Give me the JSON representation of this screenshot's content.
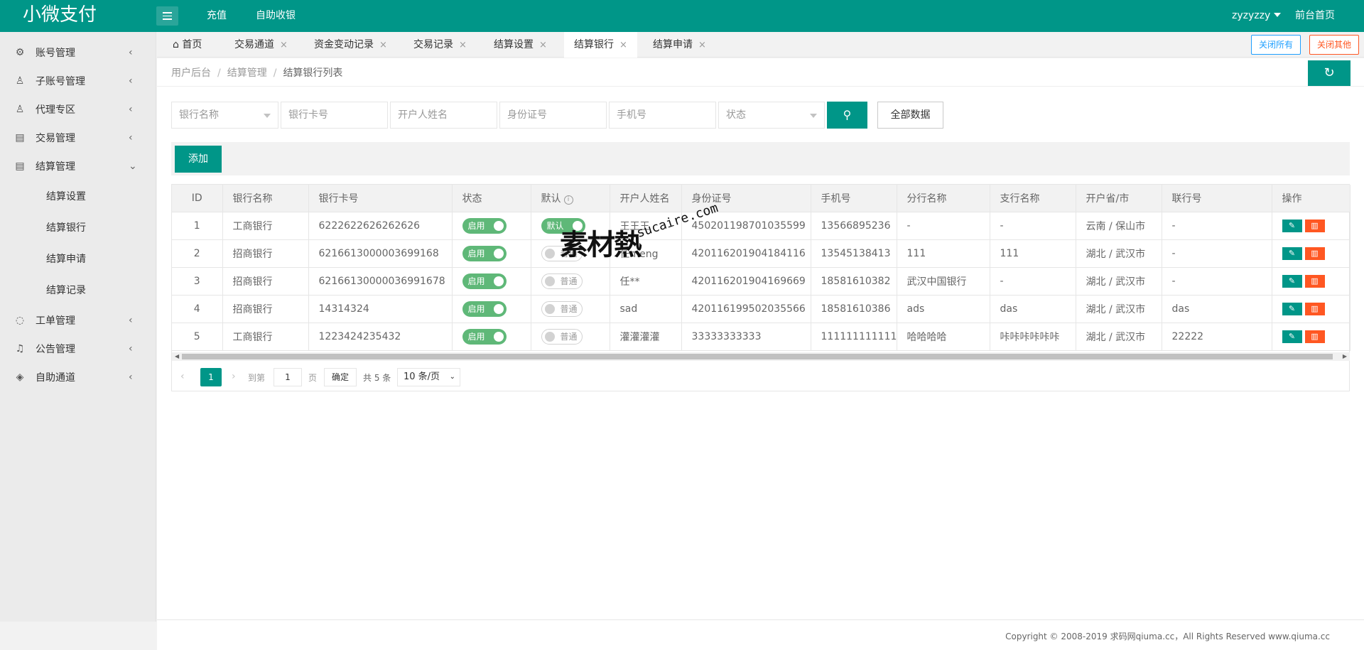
{
  "header": {
    "logo": "小微支付",
    "links": [
      "充值",
      "自助收银"
    ],
    "user": "zyzyzzy",
    "front": "前台首页"
  },
  "sidebar": {
    "items": [
      {
        "label": "账号管理",
        "icon": "gear-icon",
        "arrow": "<"
      },
      {
        "label": "子账号管理",
        "icon": "users-icon",
        "arrow": "<"
      },
      {
        "label": "代理专区",
        "icon": "user-icon",
        "arrow": "<"
      },
      {
        "label": "交易管理",
        "icon": "clipboard-icon",
        "arrow": "<"
      },
      {
        "label": "结算管理",
        "icon": "clipboard-icon",
        "arrow": "v"
      },
      {
        "label": "工单管理",
        "icon": "chat-icon",
        "arrow": "<"
      },
      {
        "label": "公告管理",
        "icon": "bell-icon",
        "arrow": "<"
      },
      {
        "label": "自助通道",
        "icon": "cube-icon",
        "arrow": "<"
      }
    ],
    "sub_items": [
      "结算设置",
      "结算银行",
      "结算申请",
      "结算记录"
    ]
  },
  "tabs": [
    {
      "label": "首页"
    },
    {
      "label": "交易通道"
    },
    {
      "label": "资金变动记录"
    },
    {
      "label": "交易记录"
    },
    {
      "label": "结算设置"
    },
    {
      "label": "结算银行"
    },
    {
      "label": "结算申请"
    }
  ],
  "tab_close": "×",
  "tab_actions": {
    "close_all": "关闭所有",
    "close_other": "关闭其他"
  },
  "breadcrumb": {
    "l1": "用户后台",
    "l2": "结算管理",
    "l3": "结算银行列表",
    "sep": "/"
  },
  "filters": {
    "bank_name": "银行名称",
    "card_no": "银行卡号",
    "holder": "开户人姓名",
    "id_no": "身份证号",
    "phone": "手机号",
    "status": "状态",
    "all_data": "全部数据"
  },
  "toolbar": {
    "add": "添加"
  },
  "table": {
    "headers": {
      "id": "ID",
      "bank": "银行名称",
      "card": "银行卡号",
      "status": "状态",
      "default": "默认",
      "holder": "开户人姓名",
      "idno": "身份证号",
      "phone": "手机号",
      "branch": "分行名称",
      "sub_branch": "支行名称",
      "region": "开户省/市",
      "union": "联行号",
      "ops": "操作"
    },
    "rows": [
      {
        "id": "1",
        "bank": "工商银行",
        "card": "6222622626262626",
        "status": "启用",
        "default": "默认",
        "holder": "王王王",
        "idno": "450201198701035599",
        "phone": "13566895236",
        "branch": "-",
        "sub_branch": "-",
        "region": "云南 / 保山市",
        "union": "-"
      },
      {
        "id": "2",
        "bank": "招商银行",
        "card": "6216613000003699168",
        "status": "启用",
        "default": "普通",
        "holder": "任meng",
        "idno": "420116201904184116",
        "phone": "13545138413",
        "branch": "111",
        "sub_branch": "111",
        "region": "湖北 / 武汉市",
        "union": "-"
      },
      {
        "id": "3",
        "bank": "招商银行",
        "card": "62166130000036991678",
        "status": "启用",
        "default": "普通",
        "holder": "任**",
        "idno": "420116201904169669",
        "phone": "18581610382",
        "branch": "武汉中国银行",
        "sub_branch": "-",
        "region": "湖北 / 武汉市",
        "union": "-"
      },
      {
        "id": "4",
        "bank": "招商银行",
        "card": "14314324",
        "status": "启用",
        "default": "普通",
        "holder": "sad",
        "idno": "420116199502035566",
        "phone": "18581610386",
        "branch": "ads",
        "sub_branch": "das",
        "region": "湖北 / 武汉市",
        "union": "das"
      },
      {
        "id": "5",
        "bank": "工商银行",
        "card": "1223424235432",
        "status": "启用",
        "default": "普通",
        "holder": "灌灌灌灌",
        "idno": "33333333333",
        "phone": "1111111111111",
        "branch": "哈哈哈哈",
        "sub_branch": "咔咔咔咔咔咔",
        "region": "湖北 / 武汉市",
        "union": "22222"
      }
    ]
  },
  "pager": {
    "current": "1",
    "goto": "到第",
    "input": "1",
    "page": "页",
    "ok": "确定",
    "total": "共 5 条",
    "size": "10 条/页"
  },
  "footer": {
    "copyright": "Copyright © 2008-2019 求码网qiuma.cc，All Rights Reserved www.qiuma.cc"
  },
  "watermark": {
    "main": "素材熱",
    "url": "sucaire.com"
  },
  "colors": {
    "primary": "#009688",
    "danger": "#ff5722",
    "info": "#1e9fff",
    "switch_on": "#5fb878"
  }
}
